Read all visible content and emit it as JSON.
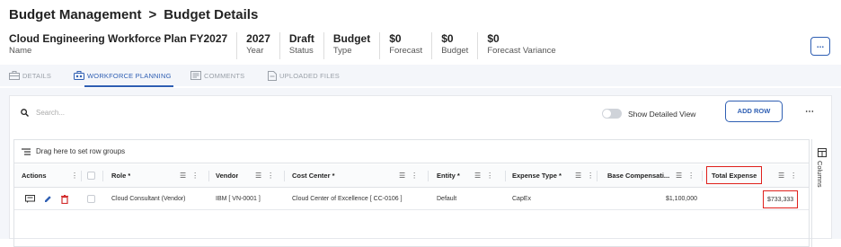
{
  "breadcrumb": {
    "parent": "Budget Management",
    "separator": ">",
    "current": "Budget Details"
  },
  "summary": [
    {
      "value": "Cloud Engineering Workforce Plan FY2027",
      "label": "Name"
    },
    {
      "value": "2027",
      "label": "Year"
    },
    {
      "value": "Draft",
      "label": "Status"
    },
    {
      "value": "Budget",
      "label": "Type"
    },
    {
      "value": "$0",
      "label": "Forecast"
    },
    {
      "value": "$0",
      "label": "Budget"
    },
    {
      "value": "$0",
      "label": "Forecast Variance"
    }
  ],
  "more_button": "...",
  "tabs": [
    {
      "label": "DETAILS",
      "icon": "briefcase-icon",
      "active": false
    },
    {
      "label": "WORKFORCE PLANNING",
      "icon": "team-icon",
      "active": true
    },
    {
      "label": "COMMENTS",
      "icon": "comments-icon",
      "active": false
    },
    {
      "label": "UPLOADED FILES",
      "icon": "file-icon",
      "active": false
    }
  ],
  "toolbar": {
    "search_placeholder": "Search...",
    "toggle_label": "Show Detailed View",
    "add_row_label": "ADD ROW",
    "kebab": "⋯"
  },
  "grid": {
    "group_panel_text": "Drag here to set row groups",
    "columns": [
      "Actions",
      "Role *",
      "Vendor",
      "Cost Center *",
      "Entity *",
      "Expense Type *",
      "Base Compensati...",
      "Total Expense"
    ],
    "rows": [
      {
        "role": "Cloud Consultant (Vendor)",
        "vendor": "IBM [ VN-0001 ]",
        "cost_center": "Cloud Center of Excellence [ CC-0106 ]",
        "entity": "Default",
        "expense_type": "CapEx",
        "base_comp": "$1,100,000",
        "total_expense": "$733,333"
      }
    ],
    "side_panel_label": "Columns"
  },
  "colors": {
    "accent": "#2f5fb3",
    "highlight": "#e0201c",
    "delete": "#d32f2f"
  }
}
